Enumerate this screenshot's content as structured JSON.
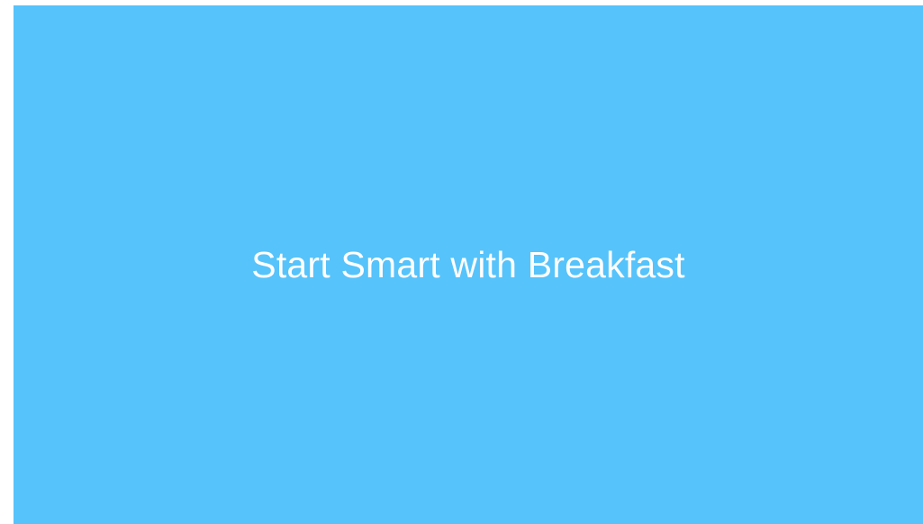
{
  "slide": {
    "title": "Start Smart with Breakfast",
    "background_color": "#56c3fb",
    "text_color": "#ffffff"
  }
}
